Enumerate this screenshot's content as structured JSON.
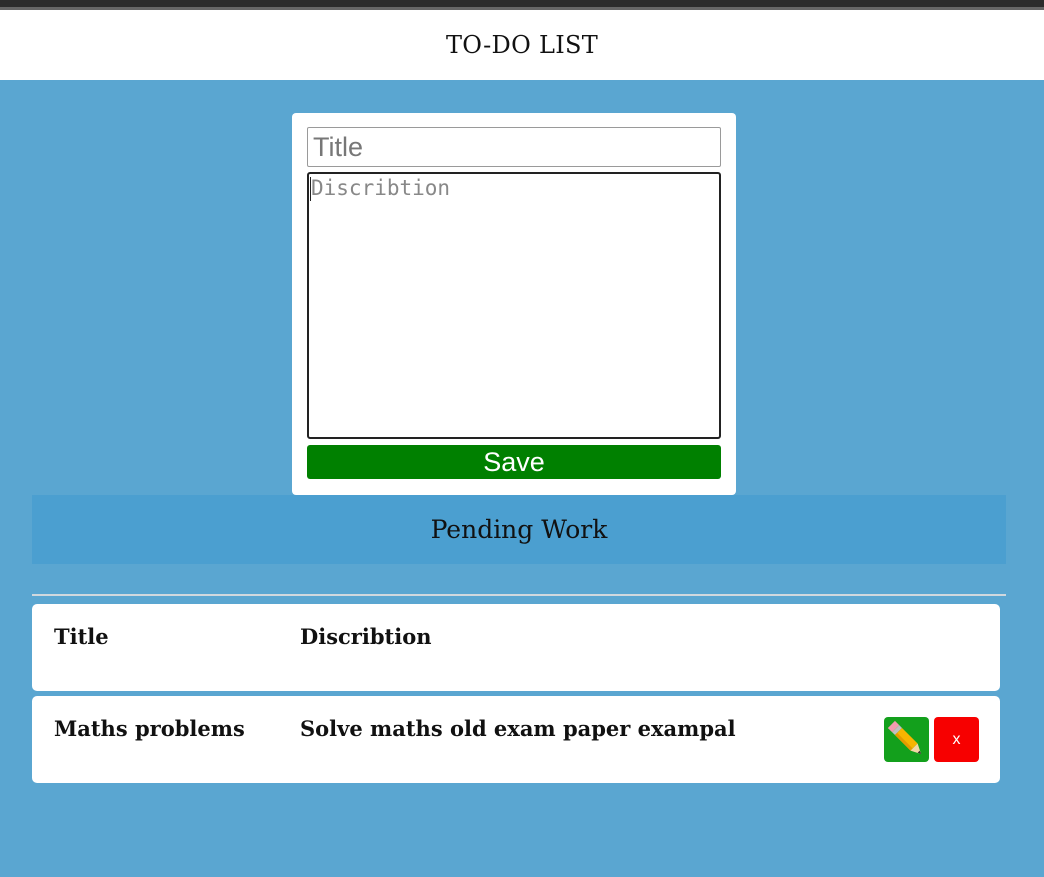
{
  "app": {
    "title": "TO-DO LIST"
  },
  "form": {
    "title_placeholder": "Title",
    "title_value": "",
    "description_placeholder": "Discribtion",
    "description_value": "",
    "save_label": "Save"
  },
  "section": {
    "heading": "Pending Work"
  },
  "table": {
    "columns": [
      "Title",
      "Discribtion"
    ],
    "rows": [
      {
        "title": "Maths problems",
        "description": "Solve maths old exam paper exampal",
        "edit_icon": "pencil-icon",
        "delete_label": "x"
      }
    ]
  },
  "colors": {
    "page_background": "#5aa6d1",
    "section_bar": "#4b9fd0",
    "save_button": "#008000",
    "edit_button": "#13a01c",
    "delete_button": "#f70000"
  }
}
